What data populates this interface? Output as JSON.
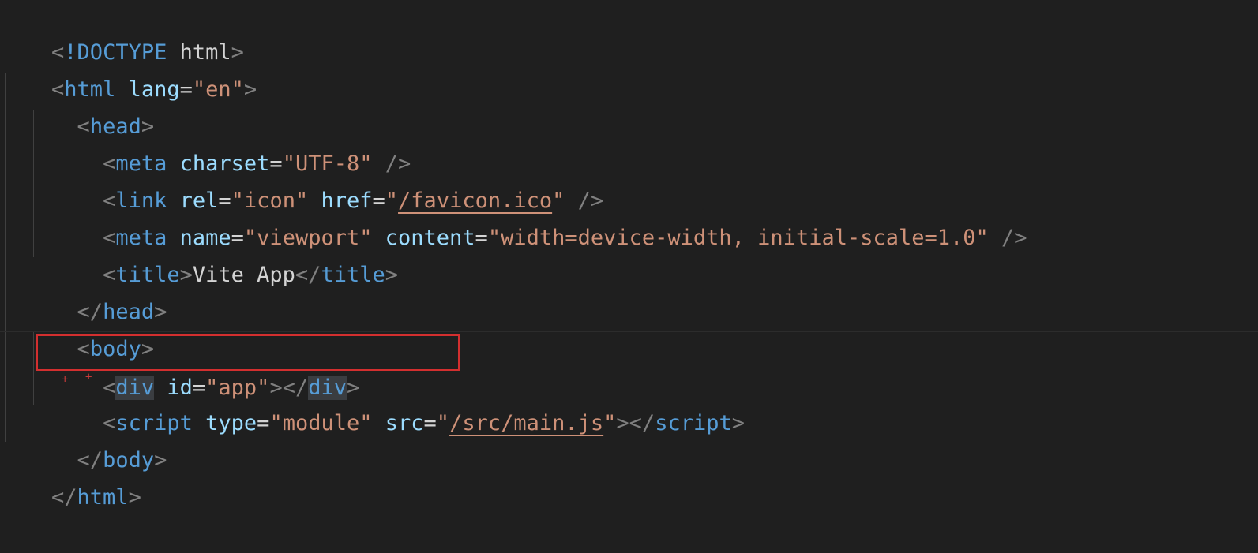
{
  "editor": {
    "colors": {
      "background": "#1f1f1f",
      "tag": "#569cd6",
      "attribute": "#9cdcfe",
      "string": "#ce9178",
      "punctuation": "#808080",
      "text": "#d4d4d4",
      "highlight_box": "#d32f2f"
    },
    "code": {
      "doctype_kw": "!DOCTYPE",
      "doctype_name": "html",
      "html": "html",
      "lang_attr": "lang",
      "lang_val": "\"en\"",
      "head": "head",
      "meta": "meta",
      "charset_attr": "charset",
      "charset_val": "\"UTF-8\"",
      "link": "link",
      "rel_attr": "rel",
      "rel_val": "\"icon\"",
      "href_attr": "href",
      "href_q1": "\"",
      "href_path": "/favicon.ico",
      "href_q2": "\"",
      "name_attr": "name",
      "name_val": "\"viewport\"",
      "content_attr": "content",
      "content_val": "\"width=device-width, initial-scale=1.0\"",
      "title": "title",
      "title_text": "Vite App",
      "body": "body",
      "div": "div",
      "id_attr": "id",
      "id_val": "\"app\"",
      "script": "script",
      "type_attr": "type",
      "type_val": "\"module\"",
      "src_attr": "src",
      "src_q1": "\"",
      "src_path": "/src/main.js",
      "src_q2": "\""
    }
  }
}
